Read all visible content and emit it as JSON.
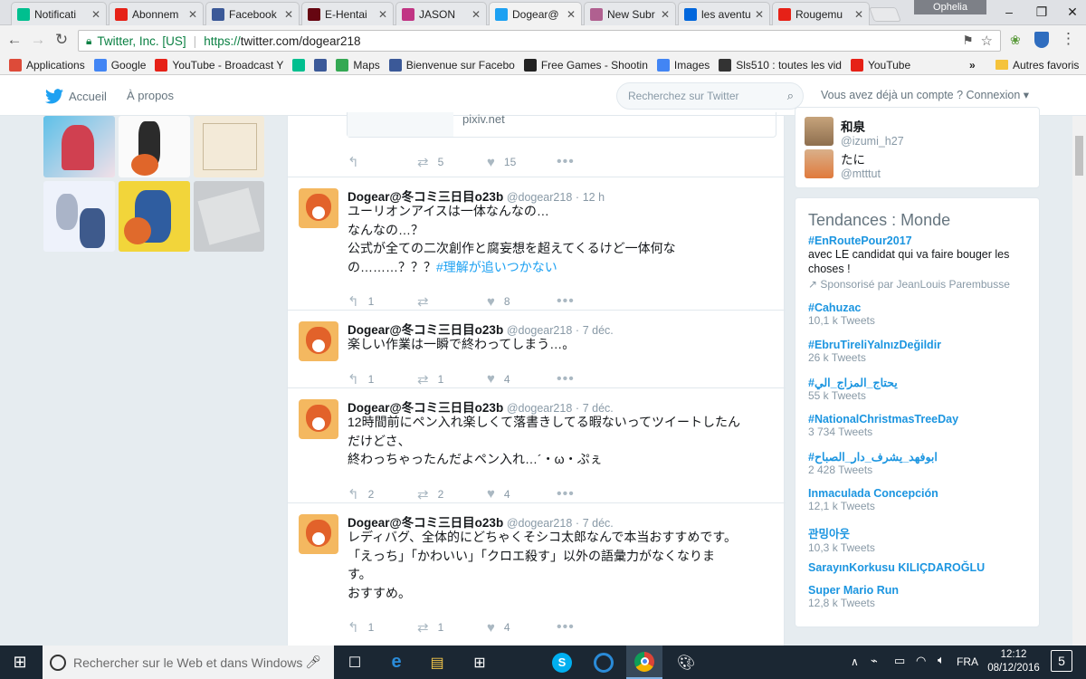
{
  "browser": {
    "tabs": [
      {
        "title": "Notificati",
        "icon": "vine-icon",
        "color": "#00bf8f"
      },
      {
        "title": "Abonnem",
        "icon": "youtube-icon",
        "color": "#e62117"
      },
      {
        "title": "Facebook",
        "icon": "facebook-icon",
        "color": "#3b5998"
      },
      {
        "title": "E-Hentai",
        "icon": "ehentai-icon",
        "color": "#660611"
      },
      {
        "title": "JASON",
        "icon": "instagram-icon",
        "color": "#c13584"
      },
      {
        "title": "Dogear@",
        "icon": "twitter-icon",
        "color": "#1da1f2"
      },
      {
        "title": "New Subr",
        "icon": "page-icon",
        "color": "#b06090"
      },
      {
        "title": "les aventu",
        "icon": "dailymotion-icon",
        "color": "#0066dc"
      },
      {
        "title": "Rougemu",
        "icon": "youtube-icon",
        "color": "#e62117"
      }
    ],
    "profile_name": "Ophelia",
    "address": {
      "org": "Twitter, Inc. [US]",
      "scheme": "https://",
      "url": "twitter.com/dogear218"
    },
    "bookmarks": [
      {
        "label": "Applications",
        "icon": "apps-grid-icon",
        "color": "#dd4b39"
      },
      {
        "label": "Google",
        "icon": "google-icon",
        "color": "#4285f4"
      },
      {
        "label": "YouTube - Broadcast Y",
        "icon": "youtube-icon",
        "color": "#e62117"
      },
      {
        "label": "",
        "icon": "vine-icon",
        "color": "#00bf8f"
      },
      {
        "label": "",
        "icon": "facebook-icon",
        "color": "#3b5998"
      },
      {
        "label": "Maps",
        "icon": "maps-icon",
        "color": "#34a853"
      },
      {
        "label": "Bienvenue sur Facebo",
        "icon": "facebook-icon",
        "color": "#3b5998"
      },
      {
        "label": "Free Games - Shootin",
        "icon": "games-icon",
        "color": "#222222"
      },
      {
        "label": "Images",
        "icon": "google-icon",
        "color": "#4285f4"
      },
      {
        "label": "Sls510 : toutes les vid",
        "icon": "w-icon",
        "color": "#333333"
      },
      {
        "label": "YouTube",
        "icon": "youtube-icon",
        "color": "#e62117"
      }
    ],
    "bookmarks_overflow": "»",
    "other_bookmarks": "Autres favoris"
  },
  "twitter_nav": {
    "home": "Accueil",
    "about": "À propos",
    "search_placeholder": "Recherchez sur Twitter",
    "login_prompt": "Vous avez déjà un compte ? Connexion"
  },
  "card_preview": {
    "domain": "pixiv.net",
    "retweets": "5",
    "likes": "15"
  },
  "tweets": [
    {
      "name": "Dogear@冬コミ三日目o23b",
      "handle": "@dogear218",
      "time": "12 h",
      "text_lines": [
        "ユーリオンアイスは一体なんなの…",
        "なんなの…？",
        "公式が全ての二次創作と腐妄想を超えてくるけど一体何な",
        "の………？？？"
      ],
      "hashtag": "#理解が追いつかない",
      "replies": "1",
      "retweets": "",
      "likes": "8"
    },
    {
      "name": "Dogear@冬コミ三日目o23b",
      "handle": "@dogear218",
      "time": "7 déc.",
      "text_lines": [
        "楽しい作業は一瞬で終わってしまう…。"
      ],
      "replies": "1",
      "retweets": "1",
      "likes": "4"
    },
    {
      "name": "Dogear@冬コミ三日目o23b",
      "handle": "@dogear218",
      "time": "7 déc.",
      "text_lines": [
        "12時間前にペン入れ楽しくて落書きしてる暇ないってツイートしたん",
        "だけどさ、",
        "終わっちゃったんだよペン入れ…´・ω・ぷぇ"
      ],
      "replies": "2",
      "retweets": "2",
      "likes": "4"
    },
    {
      "name": "Dogear@冬コミ三日目o23b",
      "handle": "@dogear218",
      "time": "7 déc.",
      "text_lines": [
        "レディバグ、全体的にどちゃくそシコ太郎なんで本当おすすめです。",
        "「えっち」「かわいい」「クロエ殺す」以外の語彙力がなくなりま",
        "す。",
        "おすすめ。"
      ],
      "replies": "1",
      "retweets": "1",
      "likes": "4"
    }
  ],
  "who_to_follow": [
    {
      "name": "和泉",
      "handle": "@izumi_h27"
    },
    {
      "name": "たに",
      "handle": "@mtttut"
    }
  ],
  "trends": {
    "title": "Tendances : Monde",
    "items": [
      {
        "name": "#EnRoutePour2017",
        "desc": "avec LE candidat qui va faire bouger les choses !",
        "promo": "Sponsorisé par JeanLouis Parembusse"
      },
      {
        "name": "#Cahuzac",
        "count": "10,1 k Tweets"
      },
      {
        "name": "#EbruTireliYalnızDeğildir",
        "count": "26 k Tweets"
      },
      {
        "name": "#يحتاج_المزاج_الي",
        "count": "55 k Tweets"
      },
      {
        "name": "#NationalChristmasTreeDay",
        "count": "3 734 Tweets"
      },
      {
        "name": "#ابوفهد_يشرف_دار_الصباح",
        "count": "2 428 Tweets"
      },
      {
        "name": "Inmaculada Concepción",
        "count": "12,1 k Tweets"
      },
      {
        "name": "관밍아웃",
        "count": "10,3 k Tweets"
      },
      {
        "name": "SarayınKorkusu KILIÇDAROĞLU",
        "count": ""
      },
      {
        "name": "Super Mario Run",
        "count": "12,8 k Tweets"
      }
    ]
  },
  "taskbar": {
    "search_placeholder": "Rechercher sur le Web et dans Windows",
    "language": "FRA",
    "time": "12:12",
    "date": "08/12/2016",
    "notifications": "5"
  }
}
